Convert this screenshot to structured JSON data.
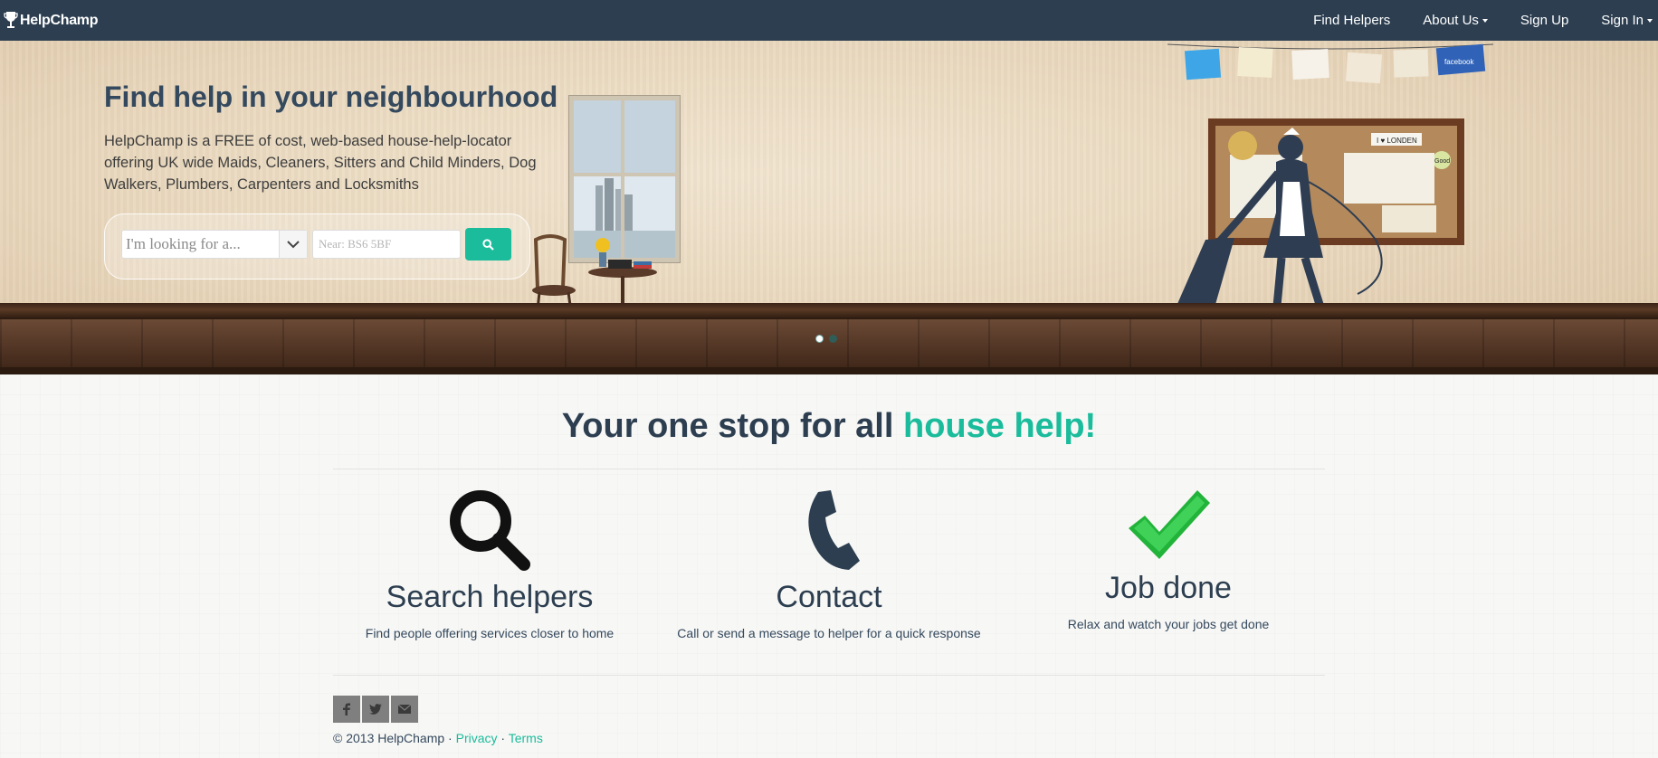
{
  "navbar": {
    "brand": "HelpChamp",
    "links": [
      {
        "label": "Find Helpers",
        "has_caret": false
      },
      {
        "label": "About Us",
        "has_caret": true
      },
      {
        "label": "Sign Up",
        "has_caret": false
      },
      {
        "label": "Sign In",
        "has_caret": true
      }
    ]
  },
  "hero": {
    "title": "Find help in your neighbourhood",
    "description": "HelpChamp is a FREE of cost, web-based house-help-locator offering UK wide Maids, Cleaners, Sitters and Child Minders, Dog Walkers, Plumbers, Carpenters and Locksmiths",
    "search": {
      "select_placeholder": "I'm looking for a...",
      "near_placeholder": "Near: BS6 5BF",
      "button_icon": "search-icon"
    },
    "carousel": {
      "slides": 2,
      "active": 1
    },
    "clothesline_labels": [
      "facebook"
    ],
    "board_labels": [
      "I ♥ LONDEN",
      "Good"
    ]
  },
  "main": {
    "tagline_part1": "Your one stop for all",
    "tagline_part2": "house help!",
    "features": [
      {
        "icon": "magnifier-icon",
        "title": "Search helpers",
        "desc": "Find people offering services closer to home"
      },
      {
        "icon": "phone-icon",
        "title": "Contact",
        "desc": "Call or send a message to helper for a quick response"
      },
      {
        "icon": "checkmark-icon",
        "title": "Job done",
        "desc": "Relax and watch your jobs get done"
      }
    ]
  },
  "footer": {
    "social": [
      "facebook-icon",
      "twitter-icon",
      "mail-icon"
    ],
    "copyright": "© 2013 HelpChamp · ",
    "privacy": "Privacy",
    "separator": " · ",
    "terms": "Terms"
  },
  "colors": {
    "navbar": "#2c3e50",
    "accent": "#1abc9c",
    "text": "#2c3e50",
    "check_green": "#22b33a"
  }
}
